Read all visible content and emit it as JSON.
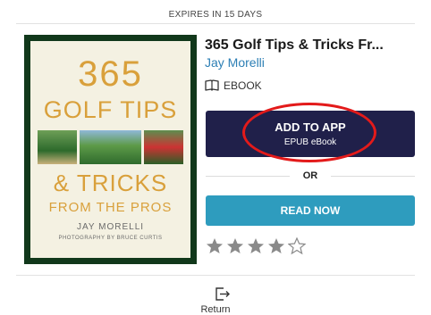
{
  "header": {
    "expires": "EXPIRES IN 15 DAYS"
  },
  "cover": {
    "line1": "365",
    "line2": "GOLF TIPS",
    "line3": "& TRICKS",
    "line4": "FROM THE PROS",
    "author": "JAY MORELLI",
    "photo_credit": "PHOTOGRAPHY BY BRUCE CURTIS"
  },
  "book": {
    "title": "365 Golf Tips & Tricks Fr...",
    "author": "Jay Morelli",
    "format_label": "EBOOK",
    "format_icon": "open-book-icon"
  },
  "actions": {
    "add_to_app_label": "ADD TO APP",
    "add_to_app_sub": "EPUB eBook",
    "or_label": "OR",
    "read_now_label": "READ NOW",
    "return_label": "Return",
    "return_icon": "return-icon"
  },
  "rating": {
    "filled": 4,
    "total": 5
  },
  "colors": {
    "primary_dark": "#20204a",
    "read_button": "#2e9cbe",
    "author_link": "#2d7fb5",
    "highlight_ring": "#e31a1a",
    "star": "#8a8a8a"
  }
}
